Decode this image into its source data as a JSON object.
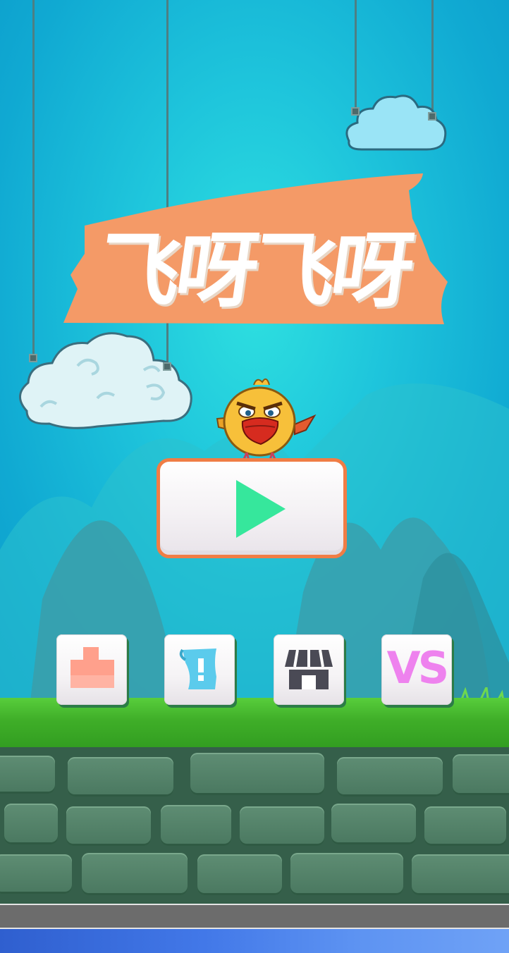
{
  "title": {
    "text": "飞呀飞呀"
  },
  "play_button": {
    "icon": "play-icon",
    "icon_color": "#36e79c",
    "border_color": "#f07d45"
  },
  "menu_buttons": [
    {
      "name": "rank",
      "icon": "podium-icon",
      "color": "#ffa08c"
    },
    {
      "name": "help",
      "icon": "scroll-icon",
      "color": "#5bcbec"
    },
    {
      "name": "shop",
      "icon": "store-icon",
      "color": "#4a4a55"
    },
    {
      "name": "versus",
      "label": "VS",
      "color": "#ee82ee"
    }
  ],
  "colors": {
    "sky": "#1fc6dc",
    "banner": "#f49a67",
    "grass": "#3fae28",
    "wall": "#4a7860"
  }
}
